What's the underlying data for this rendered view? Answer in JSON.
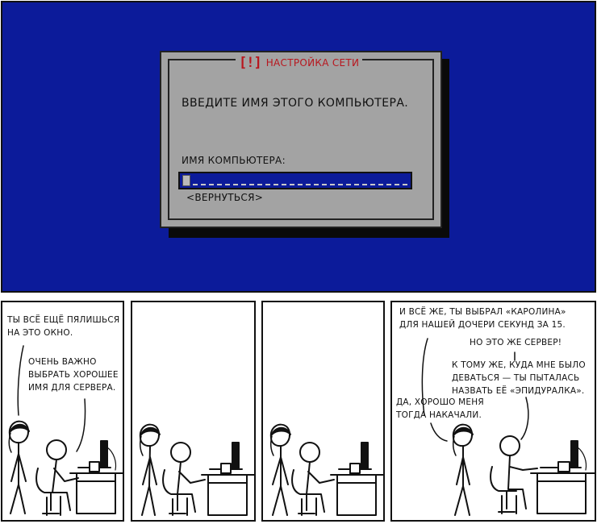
{
  "screen": {
    "dialog": {
      "title_icon": "[!]",
      "title": "НАСТРОЙКА СЕТИ",
      "prompt": "ВВЕДИТЕ ИМЯ ЭТОГО КОМПЬЮТЕРА.",
      "field_label": "ИМЯ КОМПЬЮТЕРА:",
      "field_value": "",
      "back_button": "<ВЕРНУТЬСЯ>"
    }
  },
  "panels": {
    "p1": {
      "line1": "ТЫ ВСЁ ЕЩЁ ПЯЛИШЬСЯ\nНА ЭТО ОКНО.",
      "line2": "ОЧЕНЬ ВАЖНО\nВЫБРАТЬ ХОРОШЕЕ\nИМЯ ДЛЯ СЕРВЕРА."
    },
    "p4": {
      "line1": "И ВСЁ ЖЕ, ТЫ ВЫБРАЛ «КАРОЛИНА»\nДЛЯ НАШЕЙ ДОЧЕРИ СЕКУНД ЗА 15.",
      "line2": "НО ЭТО ЖЕ СЕРВЕР!",
      "line3": "К ТОМУ ЖЕ, КУДА МНЕ БЫЛО\nДЕВАТЬСЯ — ТЫ ПЫТАЛАСЬ\nНАЗВАТЬ ЕЁ «ЭПИДУРАЛКА».",
      "line4": "ДА, ХОРОШО МЕНЯ\nТОГДА НАКАЧАЛИ."
    }
  },
  "colors": {
    "screen_bg": "#0c1b9a",
    "dialog_bg": "#a3a3a3",
    "dialog_title": "#b8161e"
  }
}
